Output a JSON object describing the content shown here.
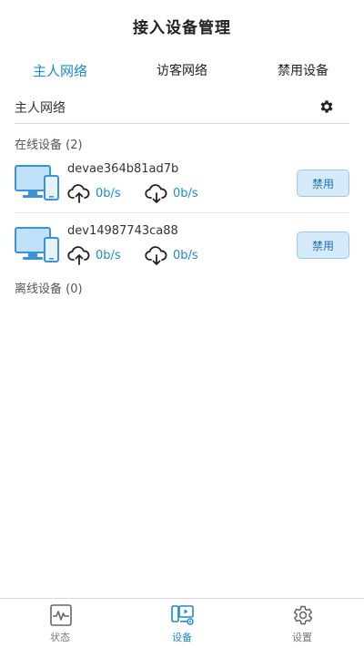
{
  "header": {
    "title": "接入设备管理"
  },
  "tabs": [
    {
      "label": "主人网络",
      "active": true
    },
    {
      "label": "访客网络",
      "active": false
    },
    {
      "label": "禁用设备",
      "active": false
    }
  ],
  "network": {
    "label": "主人网络",
    "settings_icon": "gear-icon"
  },
  "online": {
    "label": "在线设备 (2)",
    "devices": [
      {
        "name": "devae364b81ad7b",
        "upload": "0b/s",
        "download": "0b/s",
        "action": "禁用"
      },
      {
        "name": "dev14987743ca88",
        "upload": "0b/s",
        "download": "0b/s",
        "action": "禁用"
      }
    ]
  },
  "offline": {
    "label": "离线设备 (0)"
  },
  "tabbar": [
    {
      "label": "状态",
      "icon": "status-icon",
      "active": false
    },
    {
      "label": "设备",
      "icon": "devices-icon",
      "active": true
    },
    {
      "label": "设置",
      "icon": "settings-icon",
      "active": false
    }
  ],
  "colors": {
    "accent": "#1e88d3",
    "button_bg": "#d6ebfa"
  }
}
